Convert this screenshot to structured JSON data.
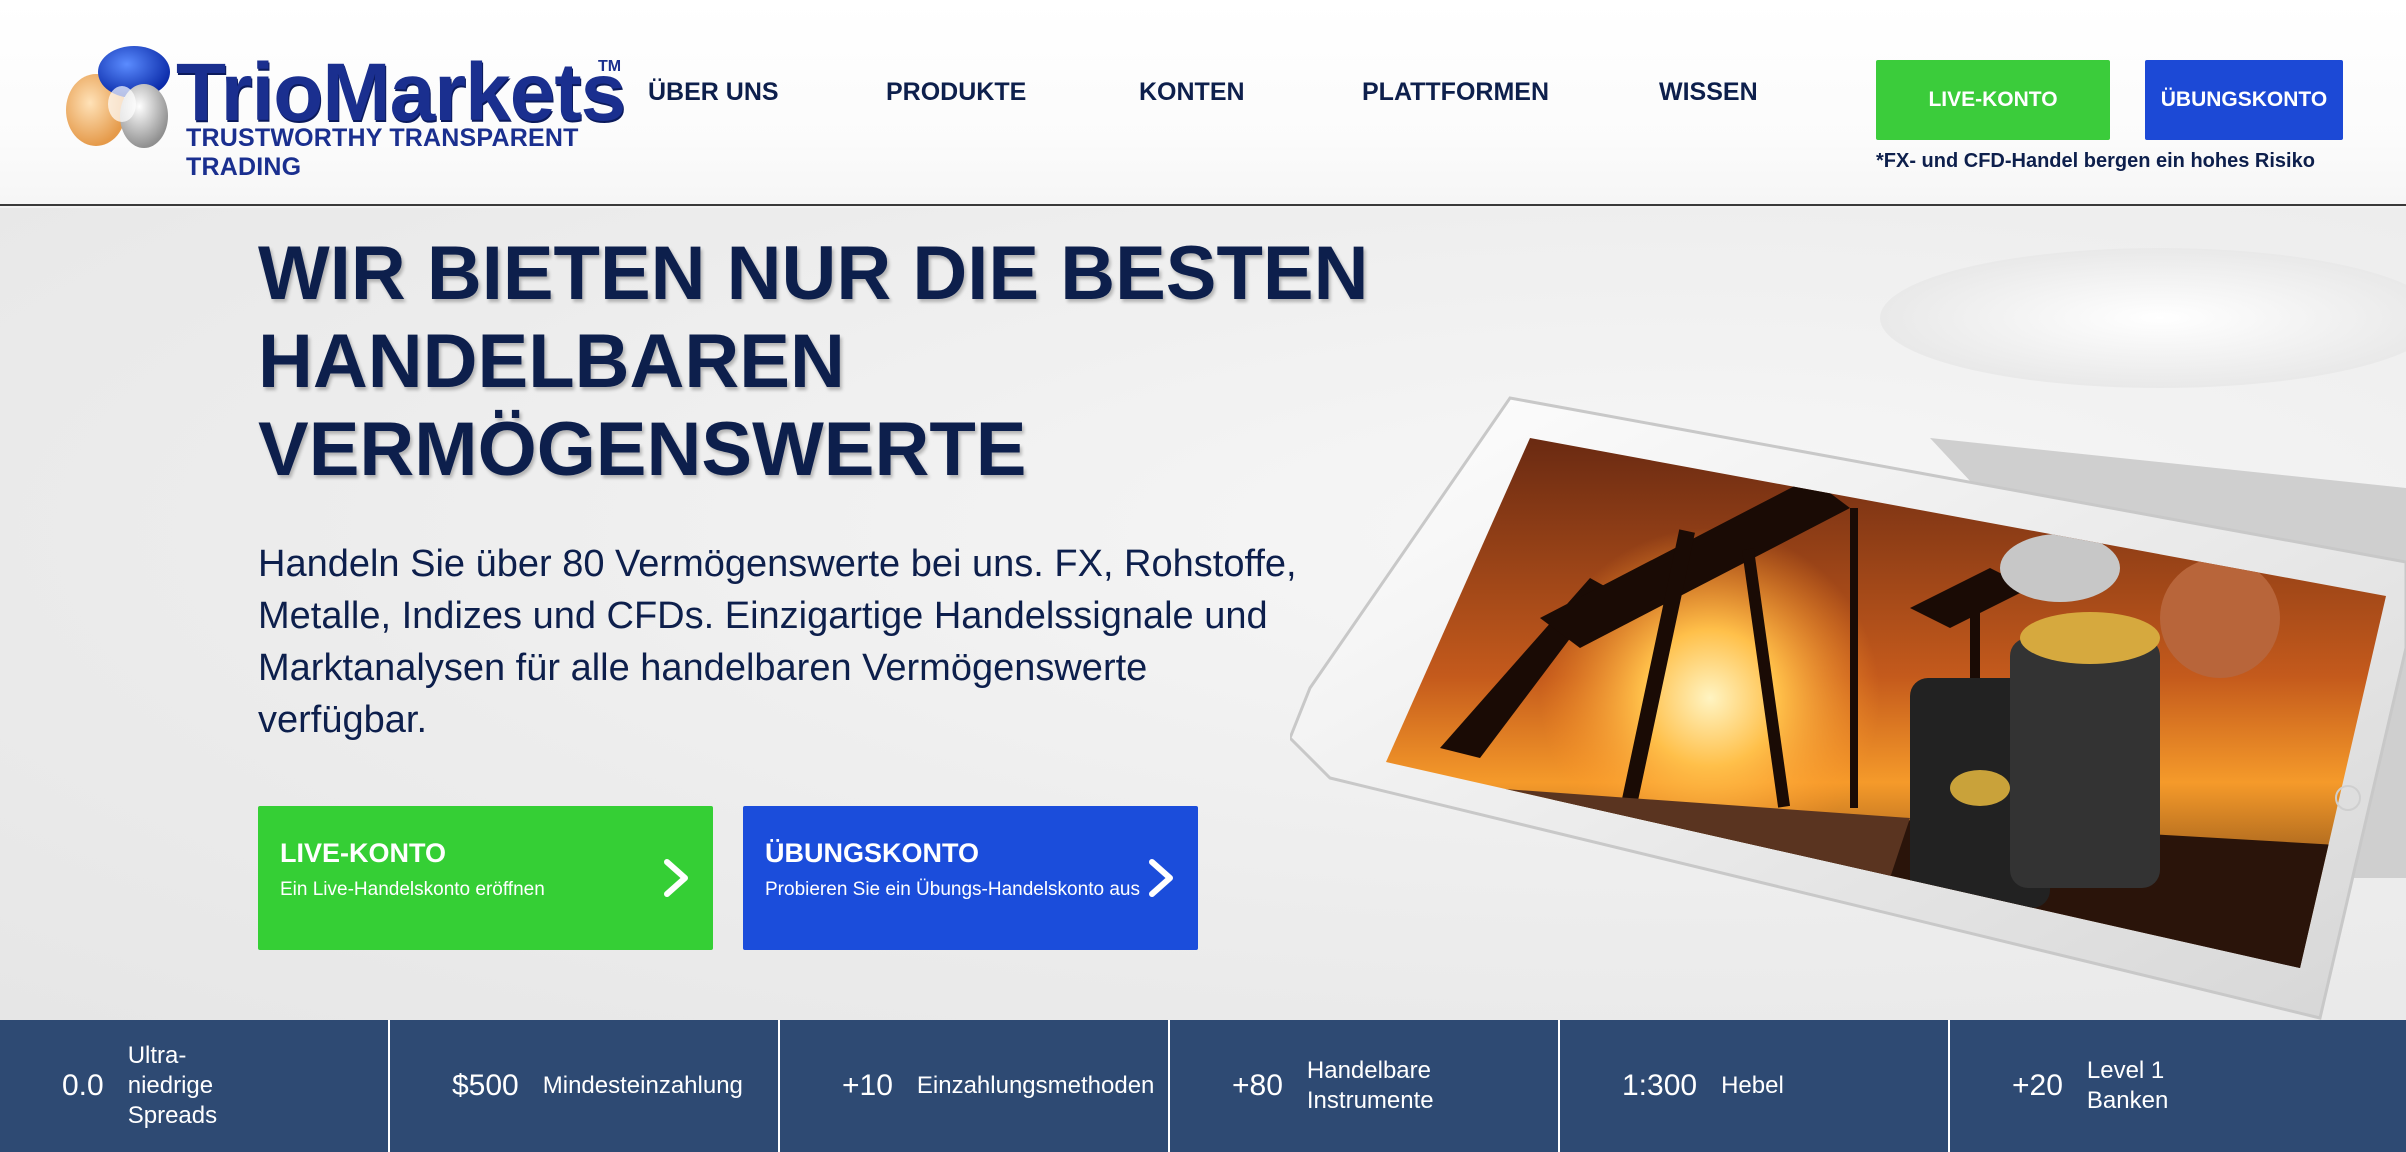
{
  "brand": {
    "name": "TrioMarkets",
    "tm": "TM",
    "tagline": "TRUSTWORTHY TRANSPARENT TRADING",
    "color": "#1a2f8f"
  },
  "nav": {
    "items": [
      {
        "label": "ÜBER UNS"
      },
      {
        "label": "PRODUKTE"
      },
      {
        "label": "KONTEN"
      },
      {
        "label": "PLATTFORMEN"
      },
      {
        "label": "WISSEN"
      }
    ]
  },
  "header_buttons": {
    "live_label": "LIVE-KONTO",
    "demo_label": "ÜBUNGSKONTO",
    "risk_note": "*FX- und CFD-Handel bergen ein hohes Risiko"
  },
  "hero": {
    "title_lines": [
      "WIR BIETEN NUR DIE BESTEN",
      "HANDELBAREN",
      "VERMÖGENSWERTE"
    ],
    "text_lines": [
      "Handeln Sie über 80 Vermögenswerte bei uns. FX, Rohstoffe,",
      "Metalle, Indizes und CFDs. Einzigartige Handelssignale und",
      "Marktanalysen für alle handelbaren Vermögenswerte",
      "verfügbar."
    ],
    "cta_live": {
      "title": "LIVE-KONTO",
      "subtitle": "Ein Live-Handelskonto eröffnen"
    },
    "cta_demo": {
      "title": "ÜBUNGSKONTO",
      "subtitle": "Probieren Sie ein Übungs-Handelskonto aus"
    }
  },
  "stats": [
    {
      "value": "0.0",
      "label_lines": [
        "Ultra-",
        "niedrige",
        "Spreads"
      ]
    },
    {
      "value": "$500",
      "label_lines": [
        "Mindesteinzahlung"
      ]
    },
    {
      "value": "+10",
      "label_lines": [
        "Einzahlungsmethoden"
      ]
    },
    {
      "value": "+80",
      "label_lines": [
        "Handelbare",
        "Instrumente"
      ]
    },
    {
      "value": "1:300",
      "label_lines": [
        "Hebel"
      ]
    },
    {
      "value": "+20",
      "label_lines": [
        "Level 1",
        "Banken"
      ]
    }
  ],
  "colors": {
    "live_green": "#35cf35",
    "demo_blue": "#1b4ddb",
    "navy_text": "#0d1f4c",
    "stats_bg": "#2e4a73"
  },
  "icons": {
    "logo_mark": "triomarkets-logo-icon",
    "cta_arrow": "chevron-right-icon"
  }
}
